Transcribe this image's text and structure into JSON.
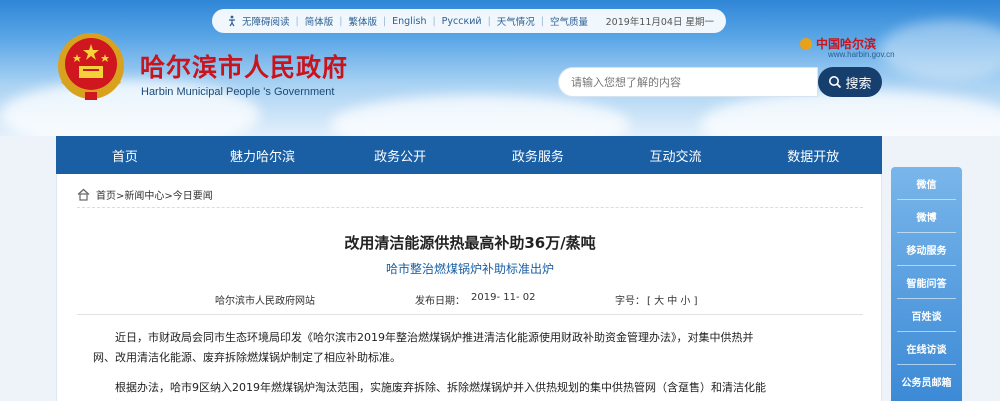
{
  "topbar": {
    "items": [
      "无障碍阅读",
      "简体版",
      "繁体版",
      "English",
      "Русский",
      "天气情况",
      "空气质量"
    ],
    "date": "2019年11月04日 星期一"
  },
  "header": {
    "title": "哈尔滨市人民政府",
    "subtitle": "Harbin Municipal People 's Government",
    "brand_name": "中国哈尔滨",
    "brand_url": "www.harbin.gov.cn"
  },
  "search": {
    "placeholder": "请输入您想了解的内容",
    "button_label": "搜索"
  },
  "nav": {
    "items": [
      "首页",
      "魅力哈尔滨",
      "政务公开",
      "政务服务",
      "互动交流",
      "数据开放"
    ]
  },
  "breadcrumb": "首页>新闻中心>今日要闻",
  "article": {
    "title": "改用清洁能源供热最高补助36万/蒸吨",
    "subtitle": "哈市整治燃煤锅炉补助标准出炉",
    "source": "哈尔滨市人民政府网站",
    "date_label": "发布日期：",
    "date": "2019- 11- 02",
    "font_label": "字号：",
    "font_sizes": "[ 大 中 小 ]",
    "para1_line1": "近日，市财政局会同市生态环境局印发《哈尔滨市2019年整治燃煤锅炉推进清洁化能源使用财政补助资金管理办法》，对集中供热并",
    "para1_line2": "网、改用清洁化能源、废弃拆除燃煤锅炉制定了相应补助标准。",
    "para2_line1": "根据办法，哈市9区纳入2019年燃煤锅炉淘汰范围，实施废弃拆除、拆除燃煤锅炉并入供热规划的集中供热管网（含趸售）和清洁化能"
  },
  "sidebar": {
    "items": [
      "微信",
      "微博",
      "移动服务",
      "智能问答",
      "百姓谈",
      "在线访谈",
      "公务员邮箱"
    ]
  },
  "colors": {
    "nav_bg": "#1a5fa4",
    "title_red": "#c8141c",
    "search_button": "#173f6e"
  }
}
